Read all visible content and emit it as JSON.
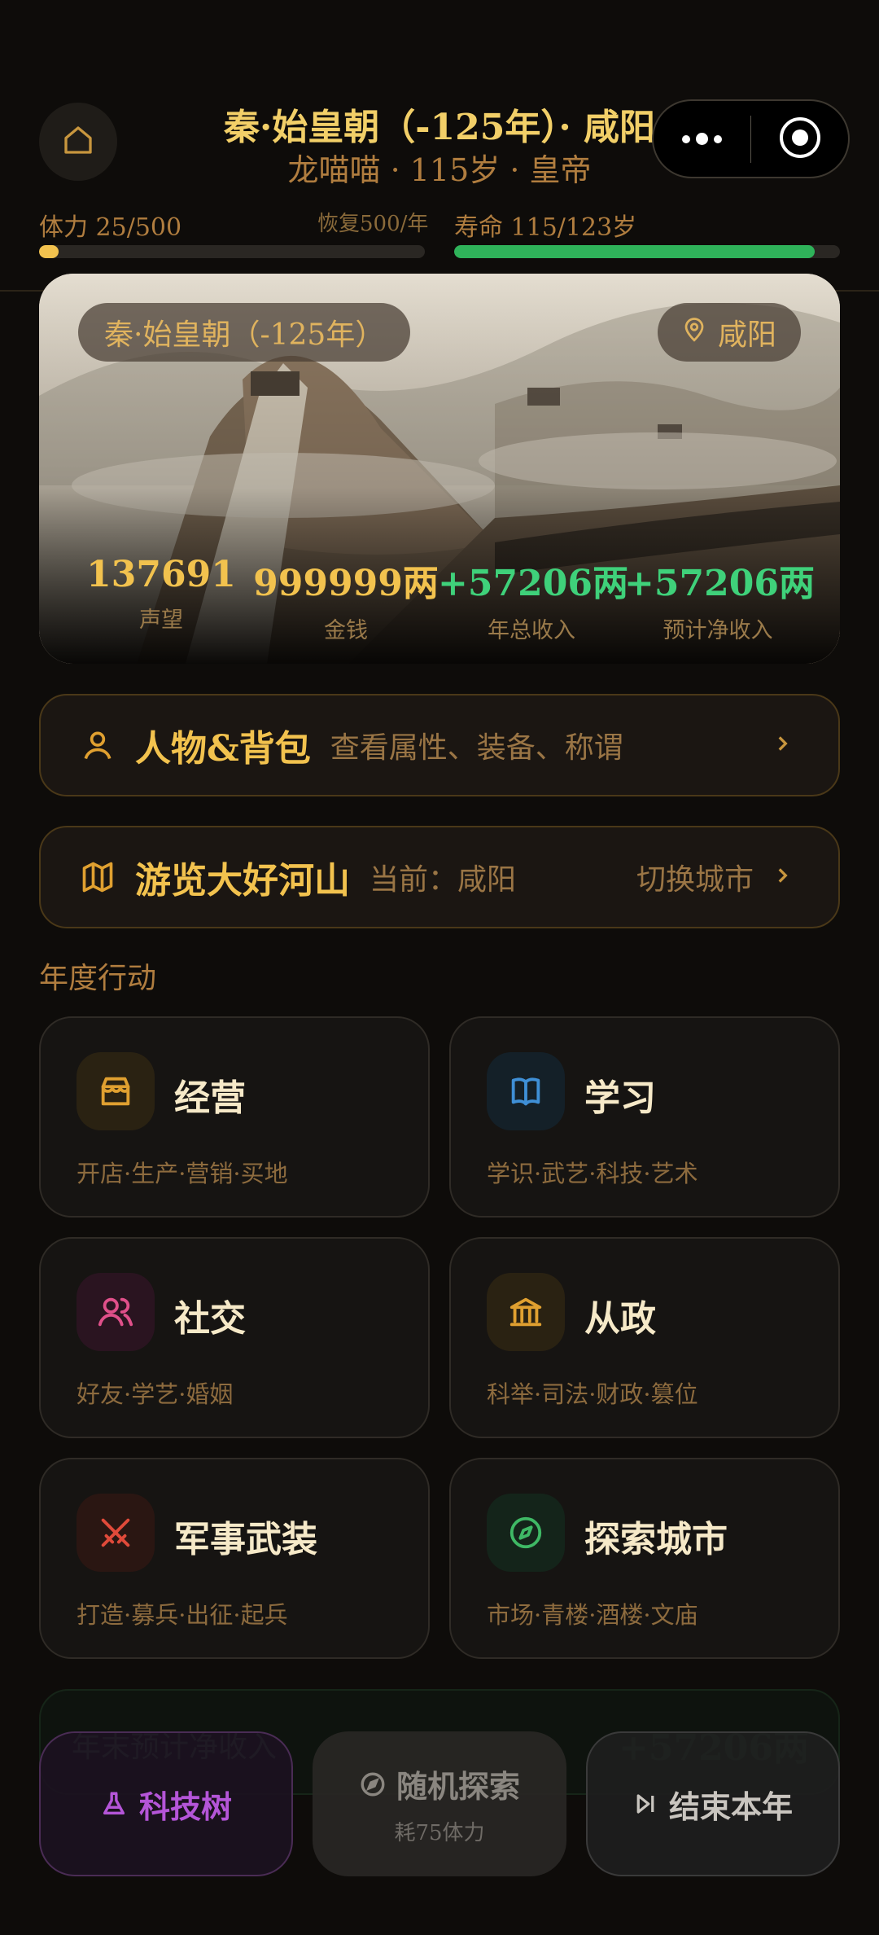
{
  "header": {
    "title": "秦·始皇朝（-125年）· 咸阳",
    "subtitle": "龙喵喵 · 115岁 · 皇帝",
    "home_icon": "home-icon",
    "more_icon": "more-dots-icon",
    "target_icon": "target-icon"
  },
  "stats": {
    "stamina_label": "体力 25/500",
    "stamina_recovery": "恢复500/年",
    "stamina_fraction": 0.05,
    "stamina_color": "#f2c24e",
    "life_label": "寿命 115/123岁",
    "life_fraction": 0.935,
    "life_color": "#2fb35a"
  },
  "hero": {
    "era_label": "秦·始皇朝（-125年）",
    "city_label": "咸阳",
    "location_icon": "location-pin-icon",
    "items": [
      {
        "value": "137691",
        "label": "声望",
        "color": "#f2c24e"
      },
      {
        "value": "999999两",
        "label": "金钱",
        "color": "#f2c24e"
      },
      {
        "value": "+57206两",
        "label": "年总收入",
        "color": "#3fd17a"
      },
      {
        "value": "+57206两",
        "label": "预计净收入",
        "color": "#3fd17a"
      }
    ]
  },
  "character_card": {
    "icon": "user-icon",
    "title": "人物&背包",
    "desc": "查看属性、装备、称谓",
    "chevron": "chevron-right-icon"
  },
  "travel_card": {
    "icon": "map-icon",
    "title": "游览大好河山",
    "current": "当前：咸阳",
    "switch_label": "切换城市",
    "chevron": "chevron-right-icon"
  },
  "section_title": "年度行动",
  "actions": [
    {
      "name": "经营",
      "sub": "开店·生产·营销·买地",
      "icon": "store-icon",
      "accent": "#e0a030",
      "bg": "#2a2212"
    },
    {
      "name": "学习",
      "sub": "学识·武艺·科技·艺术",
      "icon": "book-icon",
      "accent": "#3f8fd6",
      "bg": "#142028"
    },
    {
      "name": "社交",
      "sub": "好友·学艺·婚姻",
      "icon": "people-icon",
      "accent": "#e0508a",
      "bg": "#2a1420"
    },
    {
      "name": "从政",
      "sub": "科举·司法·财政·篡位",
      "icon": "government-icon",
      "accent": "#e0a030",
      "bg": "#2a2212"
    },
    {
      "name": "军事武装",
      "sub": "打造·募兵·出征·起兵",
      "icon": "crossed-swords-icon",
      "accent": "#e04a3a",
      "bg": "#2a1612"
    },
    {
      "name": "探索城市",
      "sub": "市场·青楼·酒楼·文庙",
      "icon": "compass-icon",
      "accent": "#3fb865",
      "bg": "#14241a"
    }
  ],
  "summary": {
    "label": "年末预计净收入",
    "value": "+57206两"
  },
  "bottom_bar": {
    "tech_label": "科技树",
    "tech_icon": "flask-icon",
    "explore_label": "随机探索",
    "explore_cost": "耗75体力",
    "explore_icon": "compass-icon",
    "end_label": "结束本年",
    "end_icon": "skip-forward-icon"
  }
}
